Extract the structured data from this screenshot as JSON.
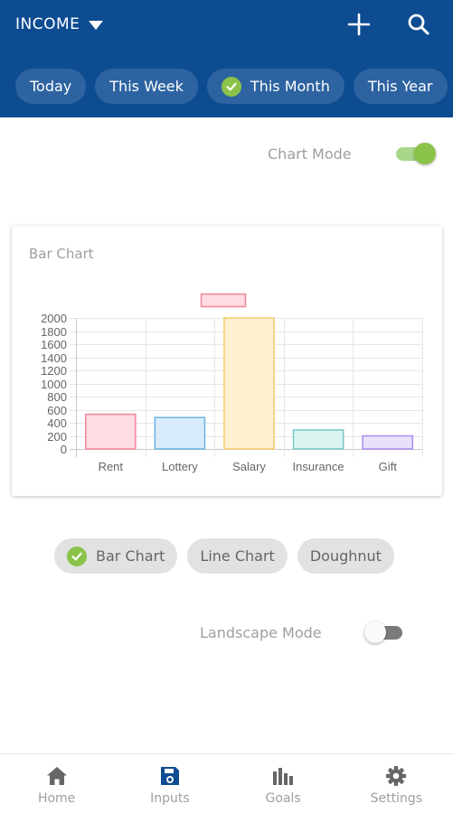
{
  "header": {
    "title": "INCOME",
    "icons": {
      "dropdown": "caret-down-icon",
      "add": "plus-icon",
      "search": "search-icon"
    },
    "background": "#0e4c92"
  },
  "periods": [
    {
      "label": "Today",
      "selected": false
    },
    {
      "label": "This Week",
      "selected": false
    },
    {
      "label": "This Month",
      "selected": true
    },
    {
      "label": "This Year",
      "selected": false
    }
  ],
  "chart_mode": {
    "label": "Chart Mode",
    "on": true
  },
  "card": {
    "title": "Bar Chart"
  },
  "chart_data": {
    "type": "bar",
    "categories": [
      "Rent",
      "Lottery",
      "Salary",
      "Insurance",
      "Gift"
    ],
    "values": [
      530,
      480,
      2000,
      290,
      200
    ],
    "ylim": [
      0,
      2000
    ],
    "yticks": [
      "0",
      "200",
      "400",
      "600",
      "800",
      "1000",
      "1200",
      "1400",
      "1600",
      "1800",
      "2000"
    ],
    "grid": true,
    "legend": "top",
    "colors": {
      "fills": [
        "#ffdbe2",
        "#d8ebfa",
        "#fff0d1",
        "#dcf3f2",
        "#ebe0fc"
      ],
      "strokes": [
        "#f2849c",
        "#6cb1e0",
        "#f7c96a",
        "#74c9c7",
        "#a98bf0"
      ]
    }
  },
  "chart_types": [
    {
      "label": "Bar Chart",
      "selected": true
    },
    {
      "label": "Line Chart",
      "selected": false
    },
    {
      "label": "Doughnut",
      "selected": false
    }
  ],
  "landscape_mode": {
    "label": "Landscape Mode",
    "on": false
  },
  "nav": [
    {
      "label": "Home",
      "icon": "home-icon",
      "active": false
    },
    {
      "label": "Inputs",
      "icon": "save-icon",
      "active": true
    },
    {
      "label": "Goals",
      "icon": "bar-chart-icon",
      "active": false
    },
    {
      "label": "Settings",
      "icon": "gear-icon",
      "active": false
    }
  ],
  "accent": "#8bc34a"
}
